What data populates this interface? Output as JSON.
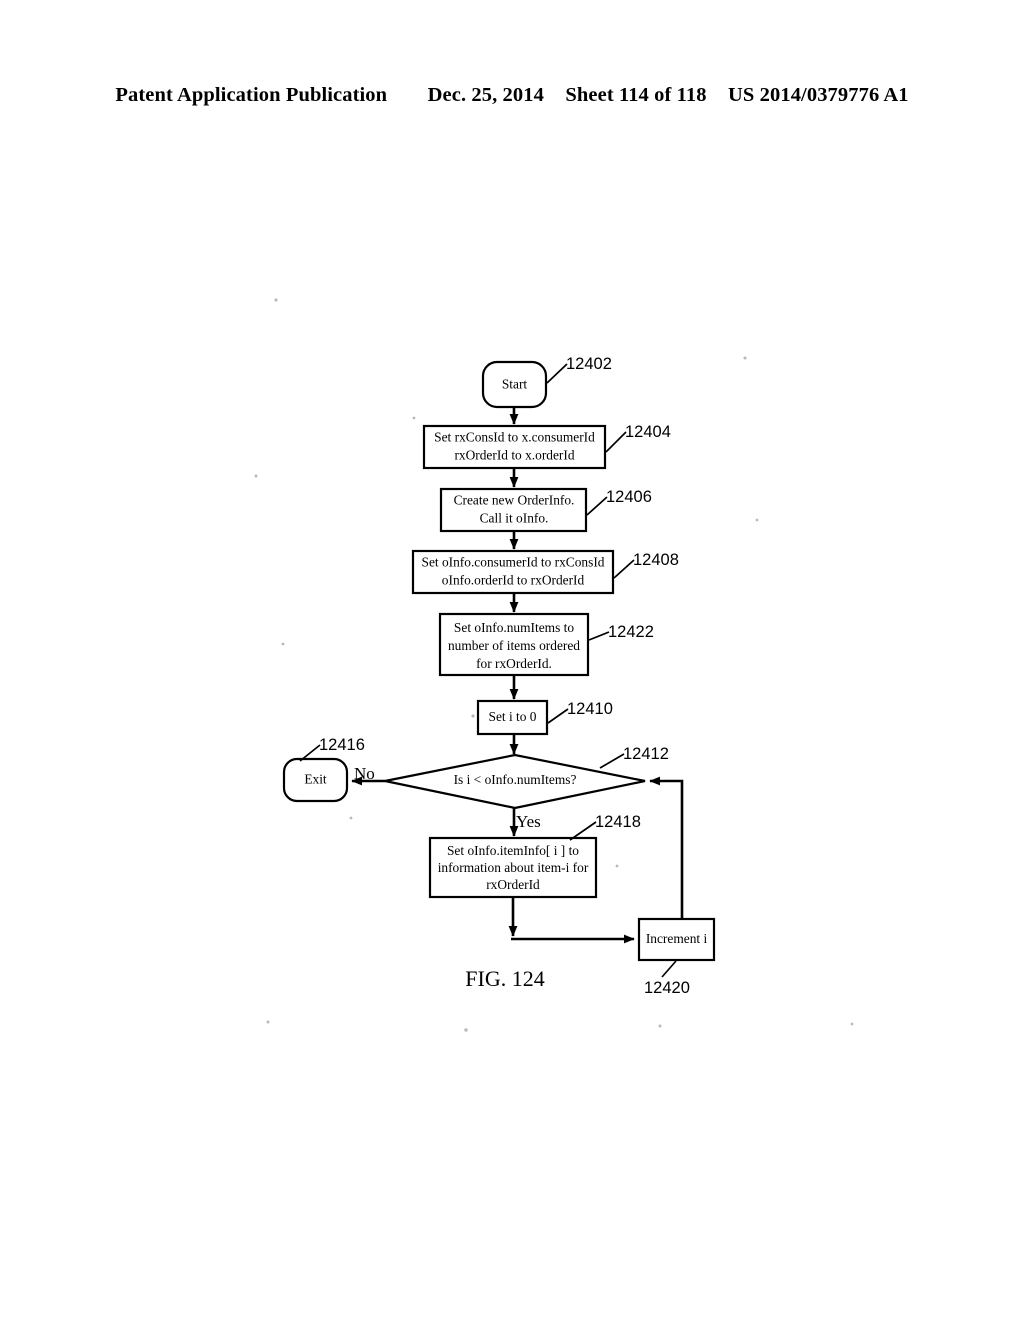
{
  "header": {
    "publication": "Patent Application Publication",
    "date": "Dec. 25, 2014",
    "sheet": "Sheet 114 of 118",
    "patent_number": "US 2014/0379776 A1"
  },
  "figure": {
    "caption": "FIG. 124"
  },
  "flowchart": {
    "nodes": [
      {
        "id": "start",
        "ref": "12402",
        "shape": "terminator",
        "text": "Start"
      },
      {
        "id": "set-rx",
        "ref": "12404",
        "shape": "process",
        "lines": [
          "Set rxConsId to x.consumerId",
          "rxOrderId to x.orderId"
        ]
      },
      {
        "id": "create-oi",
        "ref": "12406",
        "shape": "process",
        "lines": [
          "Create new OrderInfo.",
          "Call it oInfo."
        ]
      },
      {
        "id": "set-oinfo",
        "ref": "12408",
        "shape": "process",
        "lines": [
          "Set oInfo.consumerId to rxConsId",
          "oInfo.orderId to rxOrderId"
        ]
      },
      {
        "id": "set-numitems",
        "ref": "12422",
        "shape": "process",
        "lines": [
          "Set oInfo.numItems to",
          "number of items ordered",
          "for rxOrderId."
        ]
      },
      {
        "id": "set-i",
        "ref": "12410",
        "shape": "process",
        "lines": [
          "Set i to 0"
        ]
      },
      {
        "id": "decision",
        "ref": "12412",
        "shape": "decision",
        "text": "Is i < oInfo.numItems?"
      },
      {
        "id": "exit",
        "ref": "12416",
        "shape": "terminator",
        "text": "Exit"
      },
      {
        "id": "set-iteminfo",
        "ref": "12418",
        "shape": "process",
        "lines": [
          "Set oInfo.itemInfo[ i ] to",
          "information about item-i for",
          "rxOrderId"
        ]
      },
      {
        "id": "increment",
        "ref": "12420",
        "shape": "process",
        "lines": [
          "Increment i"
        ]
      }
    ],
    "branch_labels": {
      "no": "No",
      "yes": "Yes"
    }
  },
  "colors": {
    "ink": "#000000",
    "paper": "#ffffff"
  }
}
